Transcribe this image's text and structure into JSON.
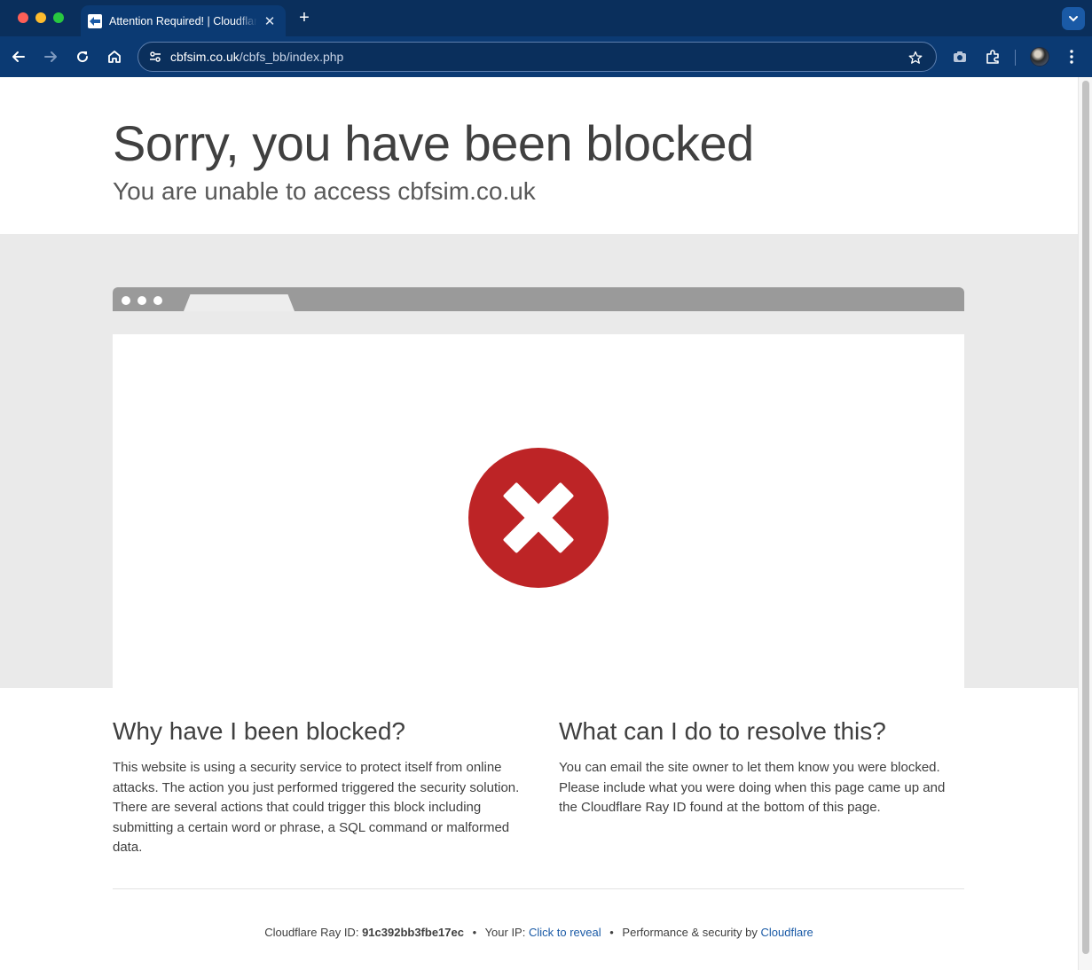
{
  "browser": {
    "tab_title": "Attention Required! | Cloudflare",
    "new_tab_label": "+",
    "close_tab_label": "✕",
    "url_host": "cbfsim.co.uk",
    "url_path": "/cbfs_bb/index.php"
  },
  "page": {
    "heading": "Sorry, you have been blocked",
    "subheading": "You are unable to access cbfsim.co.uk",
    "why": {
      "title": "Why have I been blocked?",
      "body": "This website is using a security service to protect itself from online attacks. The action you just performed triggered the security solution. There are several actions that could trigger this block including submitting a certain word or phrase, a SQL command or malformed data."
    },
    "resolve": {
      "title": "What can I do to resolve this?",
      "body": "You can email the site owner to let them know you were blocked. Please include what you were doing when this page came up and the Cloudflare Ray ID found at the bottom of this page."
    },
    "footer": {
      "ray_label": "Cloudflare Ray ID:",
      "ray_id": "91c392bb3fbe17ec",
      "separator": "•",
      "ip_label": "Your IP:",
      "ip_link": "Click to reveal",
      "perf_label": "Performance & security by",
      "perf_link": "Cloudflare"
    }
  },
  "colors": {
    "block_red": "#bd2426",
    "link_blue": "#1a5aa6",
    "chrome_blue": "#0b3a73"
  },
  "icons": {
    "block": "x-circle-icon",
    "back": "arrow-left-icon",
    "forward": "arrow-right-icon",
    "reload": "reload-icon",
    "home": "home-icon",
    "bookmark": "star-icon",
    "extensions": "puzzle-icon",
    "camera": "camera-icon",
    "menu": "more-vert-icon"
  }
}
